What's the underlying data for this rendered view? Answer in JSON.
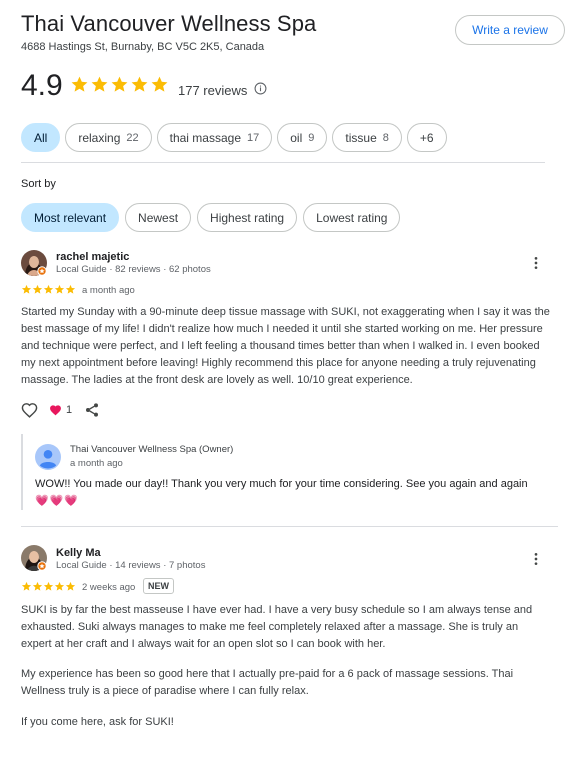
{
  "business": {
    "name": "Thai Vancouver Wellness Spa",
    "address": "4688 Hastings St, Burnaby, BC V5C 2K5, Canada",
    "write_review_label": "Write a review",
    "rating": "4.9",
    "rating_stars": 5,
    "review_count": "177 reviews"
  },
  "topics": [
    {
      "label": "All",
      "count": ""
    },
    {
      "label": "relaxing",
      "count": "22"
    },
    {
      "label": "thai massage",
      "count": "17"
    },
    {
      "label": "oil",
      "count": "9"
    },
    {
      "label": "tissue",
      "count": "8"
    },
    {
      "label": "+6",
      "count": ""
    }
  ],
  "sort": {
    "label": "Sort by",
    "options": [
      "Most relevant",
      "Newest",
      "Highest rating",
      "Lowest rating"
    ],
    "selected": "Most relevant"
  },
  "reviews": [
    {
      "name": "rachel majetic",
      "meta": "Local Guide · 82 reviews · 62 photos",
      "stars": 5,
      "when": "a month ago",
      "badge": "",
      "text": "Started my Sunday with a 90-minute deep tissue massage with SUKI, not exaggerating when I say it was the best massage of my life! I didn't realize how much I needed it until she started working on me. Her pressure and technique were perfect, and I left feeling a thousand times better than when I walked in. I even booked my next appointment before leaving! Highly recommend this place for anyone needing a truly rejuvenating massage. The ladies at the front desk are lovely as well. 10/10 great experience.",
      "likes": "1",
      "owner_reply": {
        "name": "Thai Vancouver Wellness Spa (Owner)",
        "when": "a month ago",
        "text": "WOW!! You made our day!! Thank you very much for your time considering. See you again and again",
        "emoji": "💗💗💗"
      }
    },
    {
      "name": "Kelly Ma",
      "meta": "Local Guide · 14 reviews · 7 photos",
      "stars": 5,
      "when": "2 weeks ago",
      "badge": "NEW",
      "paragraphs": [
        "SUKI is by far the best masseuse I have ever had. I have a very busy schedule so I am always tense and exhausted. Suki always manages to make me feel completely relaxed after a massage. She is truly an expert at her craft and I always wait for an open slot so I can book with her.",
        "My experience has been so good here that I actually pre-paid for a 6 pack of massage sessions. Thai Wellness truly is a piece of paradise where I can fully relax.",
        "If you come here, ask for SUKI!"
      ]
    }
  ],
  "colors": {
    "star": "#fbbc04",
    "accent": "#1a73e8",
    "chip_active": "#c2e7ff",
    "heart": "#e8175d"
  }
}
